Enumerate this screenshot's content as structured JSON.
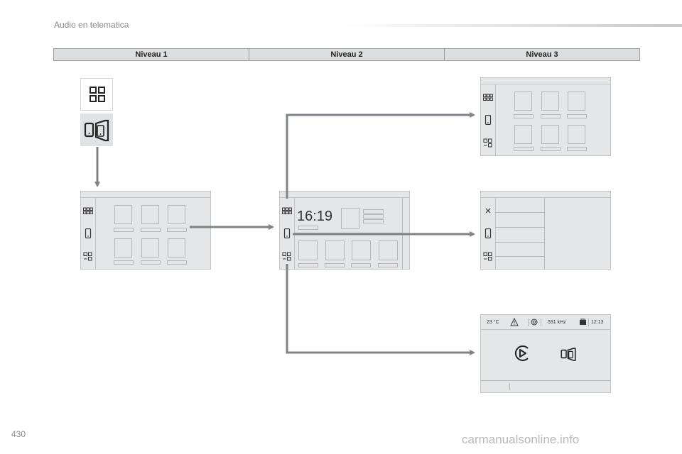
{
  "header": {
    "section_title": "Audio en telematica"
  },
  "levels": [
    "Niveau 1",
    "Niveau 2",
    "Niveau 3"
  ],
  "screens": {
    "home": {
      "clock": "16:19"
    },
    "status": {
      "temperature": "23 °C",
      "frequency": "531 kHz",
      "time": "12:13"
    }
  },
  "footer": {
    "page_number": "430",
    "watermark": "carmanualsonline.info"
  },
  "colors": {
    "arrow": "#7f8387",
    "screen_bg": "#e5e6e8",
    "level_bar": "#dcdee0"
  }
}
